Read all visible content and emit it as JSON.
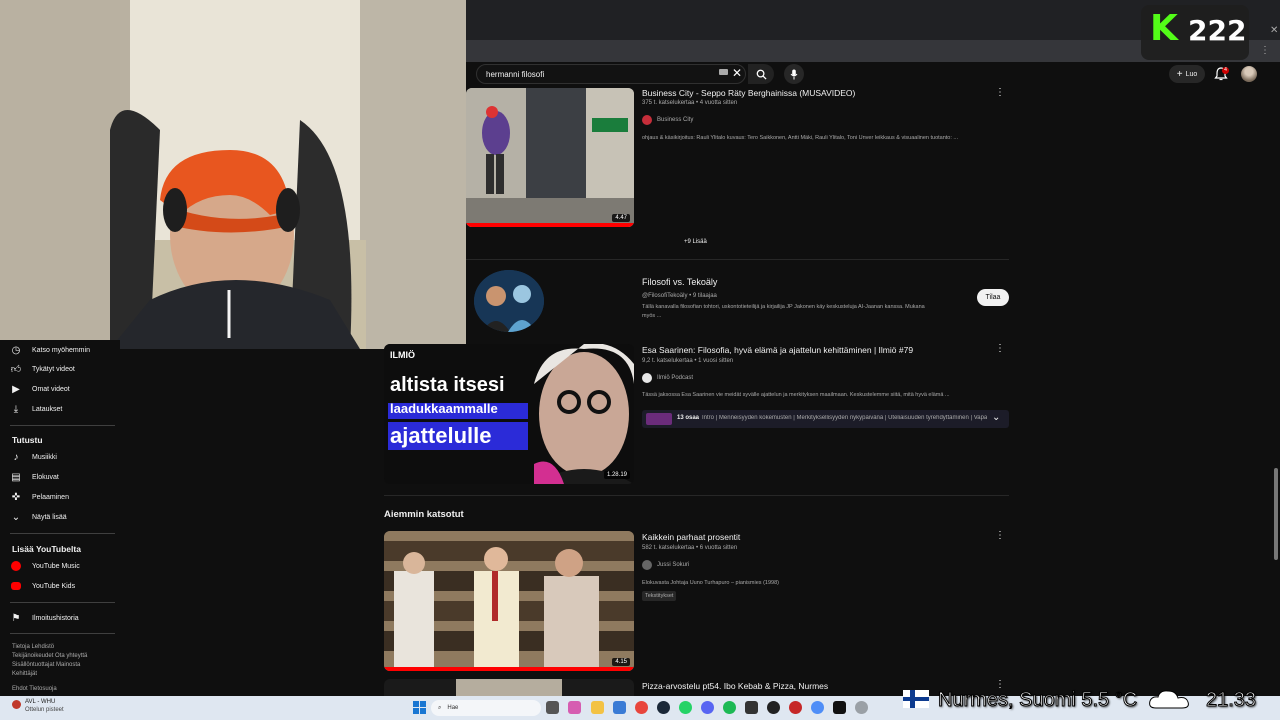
{
  "overlay": {
    "k_letter": "K",
    "count": "222"
  },
  "search": {
    "query": "hermanni filosofi"
  },
  "header": {
    "create_label": "Luo",
    "notification_count": "4"
  },
  "sidebar": {
    "items_top": [
      {
        "label": "Katso myöhemmin",
        "icon": "clock-icon"
      },
      {
        "label": "Tykätyt videot",
        "icon": "thumbs-up-icon"
      },
      {
        "label": "Omat videot",
        "icon": "play-box-icon"
      },
      {
        "label": "Lataukset",
        "icon": "download-icon"
      }
    ],
    "explore_heading": "Tutustu",
    "explore_items": [
      {
        "label": "Musiikki",
        "icon": "music-note-icon"
      },
      {
        "label": "Elokuvat",
        "icon": "film-icon"
      },
      {
        "label": "Pelaaminen",
        "icon": "gamepad-icon"
      },
      {
        "label": "Näytä lisää",
        "icon": "chevron-down-icon"
      }
    ],
    "more_heading": "Lisää YouTubelta",
    "more_items": [
      {
        "label": "YouTube Music",
        "icon": "youtube-music-icon"
      },
      {
        "label": "YouTube Kids",
        "icon": "youtube-kids-icon"
      }
    ],
    "report_item": {
      "label": "Ilmoitushistoria",
      "icon": "flag-icon"
    },
    "footer_1": "Tietoja  Lehdistö",
    "footer_2": "Tekijänoikeudet  Ota yhteyttä",
    "footer_3": "Sisällöntuottajat  Mainosta",
    "footer_4": "Kehittäjät",
    "footer_5": "Ehdot  Tietosuoja"
  },
  "results": {
    "video1": {
      "title": "Business City - Seppo Räty Berghainissa (MUSAVIDEO)",
      "meta": "375 t. katselukertaa • 4 vuotta sitten",
      "channel": "Business City",
      "description": "ohjaus & käsikirjoitus: Rauli Ylitalo kuvaus: Tero Saikkonen, Antti Mäki, Rauli Ylitalo, Toni Unver leikkaus & visuaalinen tuotanto: ...",
      "duration": "4.47"
    },
    "more_label": "+9 Lisää",
    "channel_card": {
      "avatar_text": "FILOSOFI VS. TEKOÄLY",
      "name": "Filosofi vs. Tekoäly",
      "handle": "@FilosofiTekoäly • 9 tilaajaa",
      "description_1": "Tällä kanavalla filosofian tohtori, uskontotieteilijä ja kirjailija JP Jakonen käy keskusteluja AI-Jaanan kanssa. Mukana",
      "description_2": "myös ...",
      "subscribe_label": "Tilaa"
    },
    "video2": {
      "thumb_tag": "ILMIÖ",
      "thumb_line1": "altista itsesi",
      "thumb_line2": "laadukkaammalle",
      "thumb_line3": "ajattelulle",
      "title": "Esa Saarinen: Filosofia, hyvä elämä ja ajattelun kehittäminen | Ilmiö #79",
      "meta": "9,2 t. katselukertaa • 1 vuosi sitten",
      "channel": "Ilmiö Podcast",
      "description": "Tässä jaksossa Esa Saarinen vie meidät syvälle ajattelun ja merkityksen maailmaan. Keskustelemme siitä, mitä hyvä elämä ...",
      "chapters_count": "13 osaa",
      "chapters_text": "Intro | Menneisyyden kokemusten | Merkityksellisyyden nykypäivänä | Uteliaisuuden tyrehdyttäminen | Vapa...",
      "duration": "1.28.19"
    },
    "section_heading": "Aiemmin katsotut",
    "video3": {
      "title": "Kaikkein parhaat prosentit",
      "meta": "582 t. katselukertaa • 6 vuotta sitten",
      "channel": "Jussi Sokuri",
      "description": "Elokuvasta Johtaja Uuno Turhapuro – pianismies (1998)",
      "badge": "Tekstitykset",
      "duration": "4.15"
    },
    "video4": {
      "title": "Pizza-arvostelu pt54. Ibo Kebab & Pizza, Nurmes"
    }
  },
  "taskbar": {
    "weather_city": "AVL - WHU",
    "weather_sub": "Ottelun pisteet",
    "search_placeholder": "Hae",
    "weather_overlay": "Nurmes, Suomi   5.5 °C",
    "clock": "21.33"
  },
  "colors": {
    "accent_red": "#ff0000",
    "kick_green": "#53fc18",
    "background": "#0f0f0f"
  }
}
